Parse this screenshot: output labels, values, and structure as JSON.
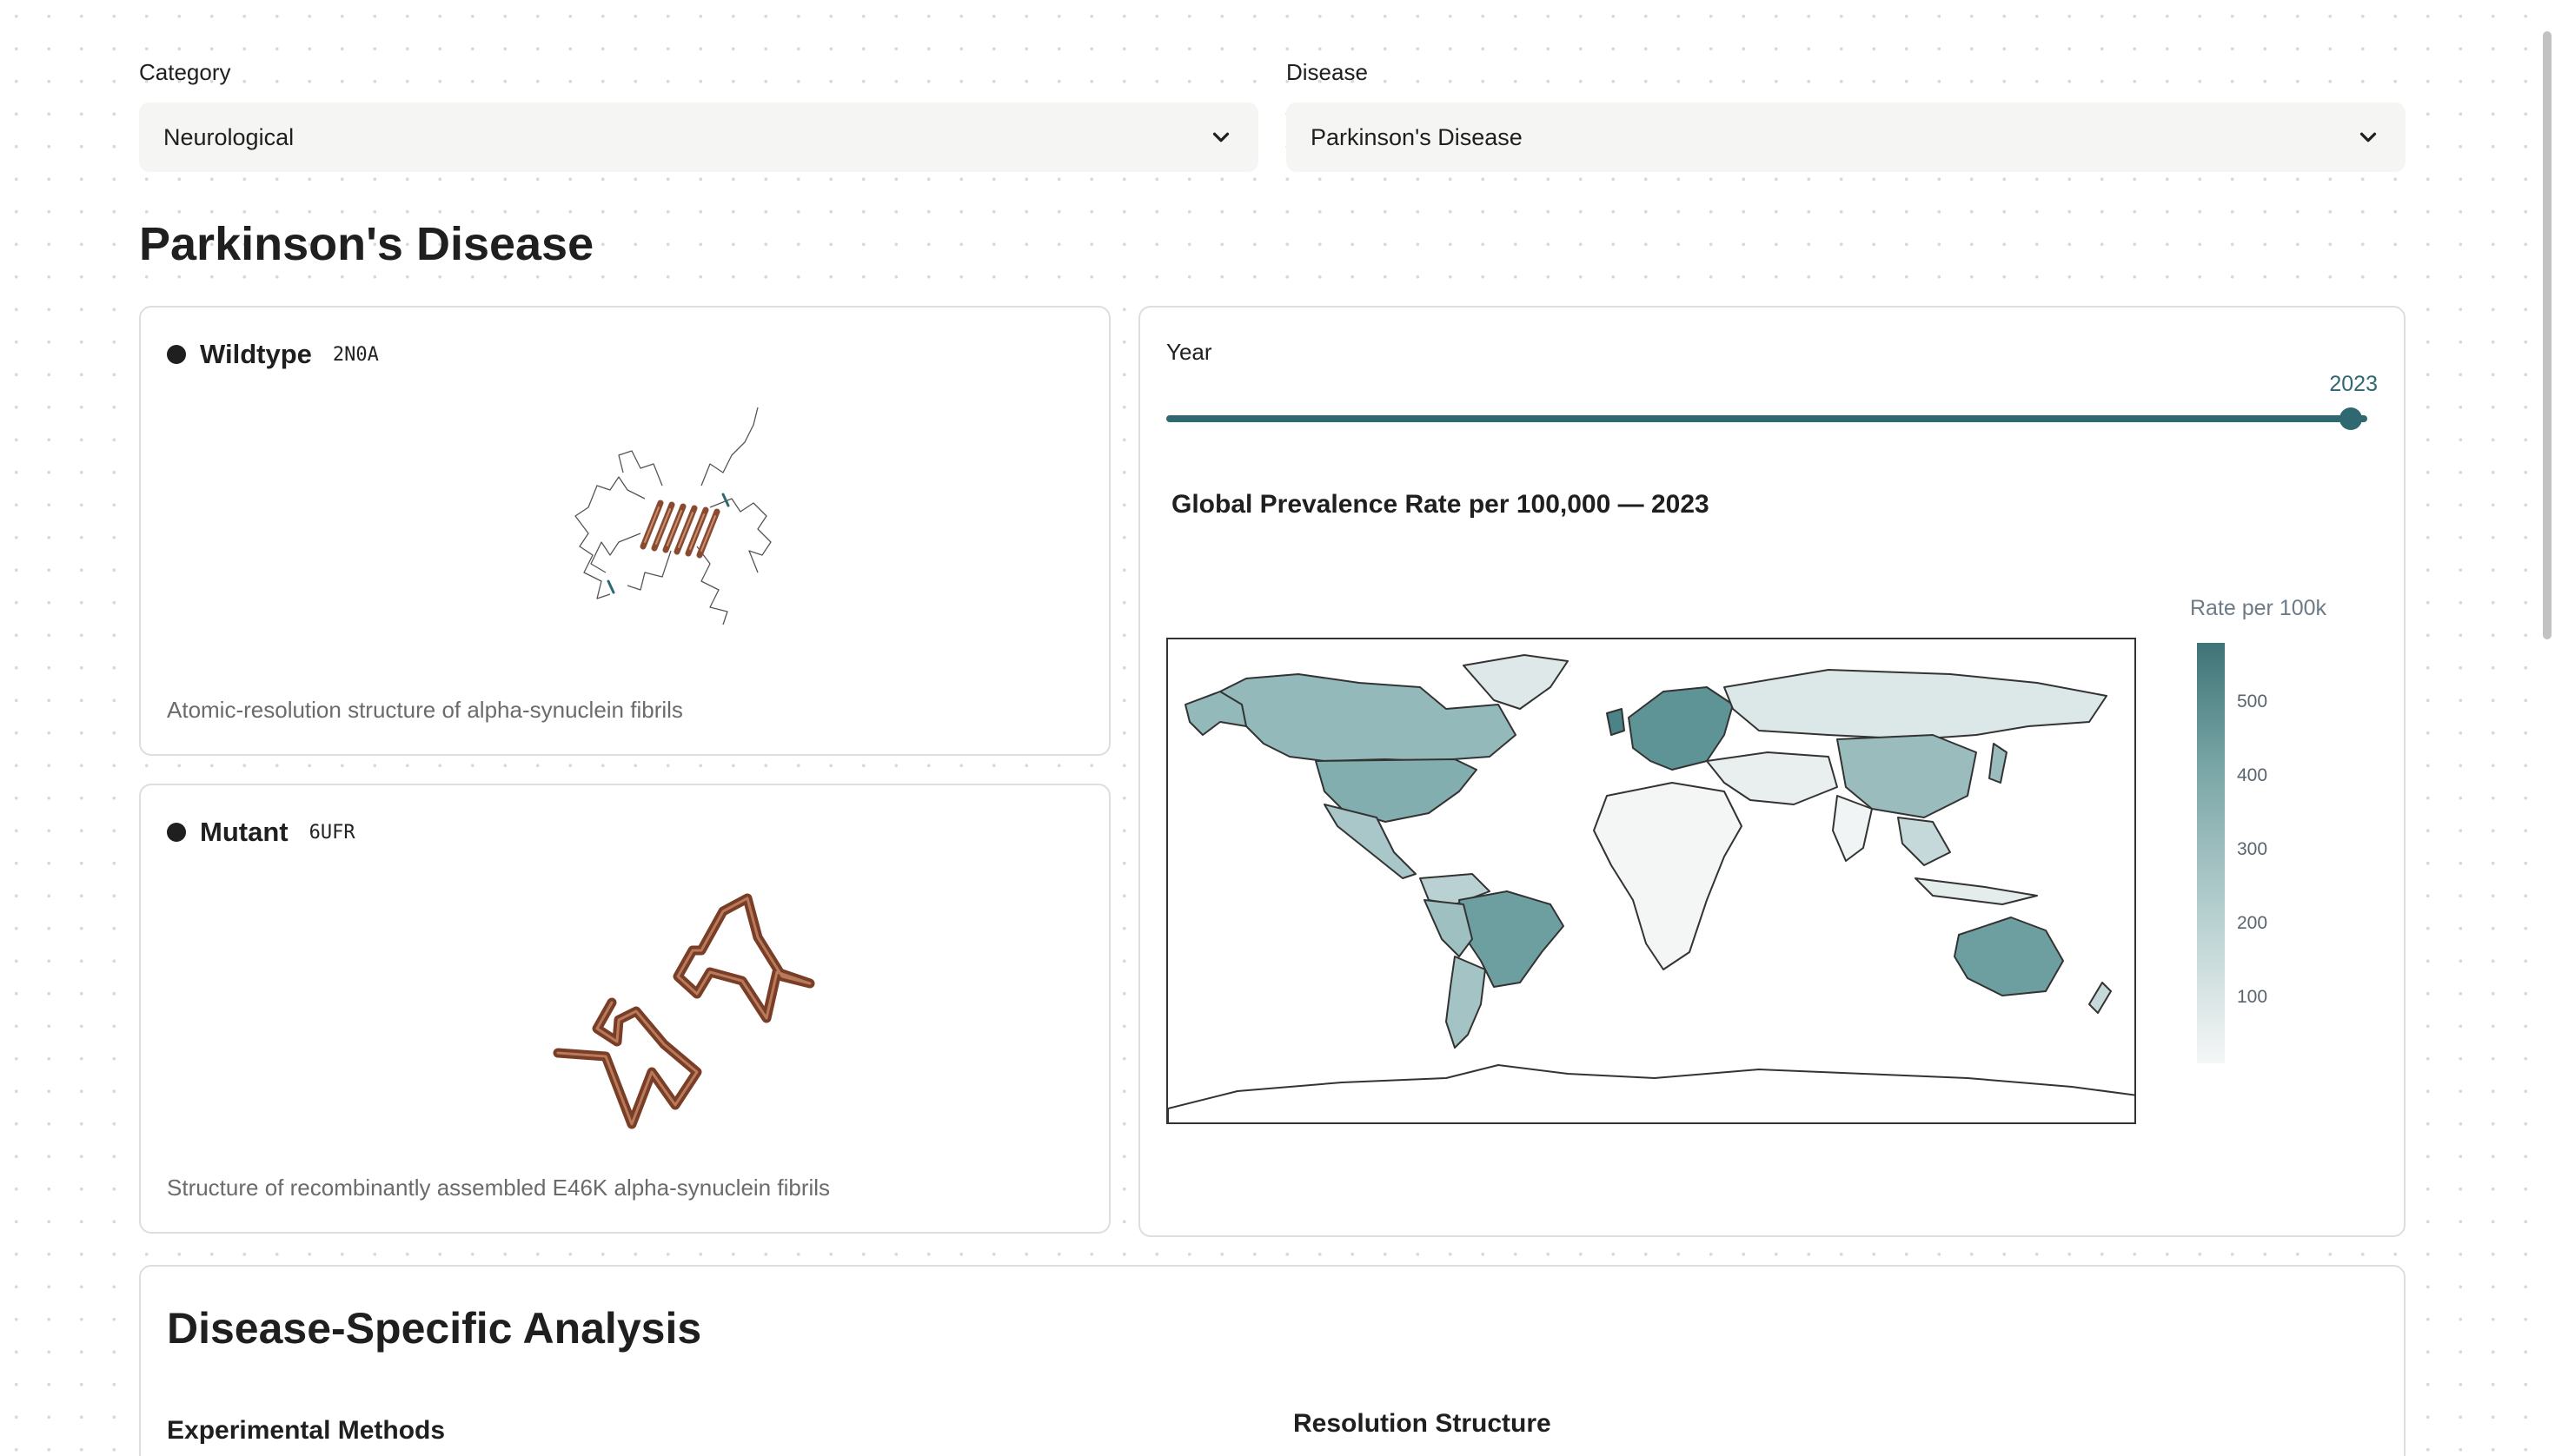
{
  "filters": {
    "category": {
      "label": "Category",
      "value": "Neurological"
    },
    "disease": {
      "label": "Disease",
      "value": "Parkinson's Disease"
    }
  },
  "page_title": "Parkinson's Disease",
  "proteins": {
    "wildtype": {
      "name": "Wildtype",
      "pdb": "2N0A",
      "description": "Atomic-resolution structure of alpha-synuclein fibrils"
    },
    "mutant": {
      "name": "Mutant",
      "pdb": "6UFR",
      "description": "Structure of recombinantly assembled E46K alpha-synuclein fibrils"
    }
  },
  "map_panel": {
    "year_label": "Year",
    "year_value": "2023",
    "slider_fraction": 1.0,
    "title": "Global Prevalence Rate per 100,000 — 2023",
    "legend_title": "Rate per 100k",
    "legend_ticks": [
      "500",
      "400",
      "300",
      "200",
      "100"
    ]
  },
  "analysis": {
    "title": "Disease-Specific Analysis",
    "experimental_methods": "Experimental Methods",
    "resolution_structure": "Resolution Structure"
  },
  "colors": {
    "accent": "#2f6870",
    "protein": "#8a4a30",
    "map_high": "#3f7477",
    "map_low": "#f5f7f7"
  },
  "icons": {
    "select_chevron": "chevron-down-icon"
  }
}
